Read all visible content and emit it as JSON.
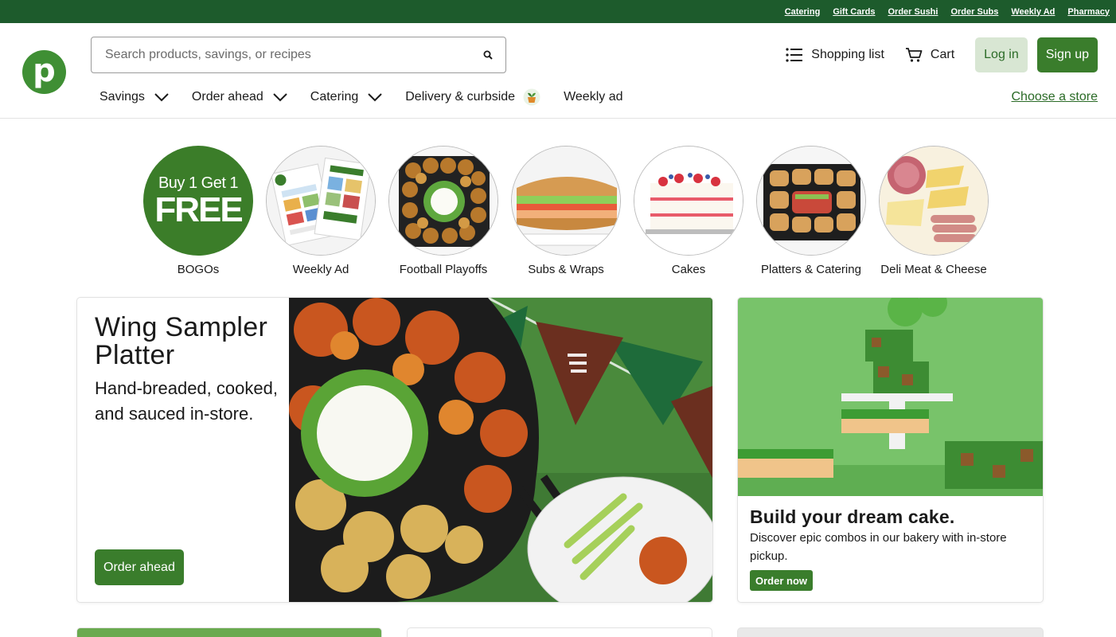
{
  "utility_links": [
    "Catering",
    "Gift Cards",
    "Order Sushi",
    "Order Subs",
    "Weekly Ad",
    "Pharmacy"
  ],
  "logo": {
    "letter": "p"
  },
  "search": {
    "placeholder": "Search products, savings, or recipes",
    "value": ""
  },
  "header": {
    "shopping_list": "Shopping list",
    "cart": "Cart",
    "login": "Log in",
    "signup": "Sign up"
  },
  "nav": {
    "items": [
      {
        "label": "Savings",
        "has_dropdown": true
      },
      {
        "label": "Order ahead",
        "has_dropdown": true
      },
      {
        "label": "Catering",
        "has_dropdown": true
      },
      {
        "label": "Delivery & curbside",
        "has_dropdown": false
      },
      {
        "label": "Weekly ad",
        "has_dropdown": false
      }
    ],
    "choose_store": "Choose a store"
  },
  "bogo_badge": {
    "line1": "Buy 1 Get 1",
    "line2": "FREE"
  },
  "categories": [
    {
      "label": "BOGOs",
      "icon": "bogo-badge"
    },
    {
      "label": "Weekly Ad",
      "icon": "weekly-ad-flyer"
    },
    {
      "label": "Football Playoffs",
      "icon": "wing-platter"
    },
    {
      "label": "Subs & Wraps",
      "icon": "sub-sandwich"
    },
    {
      "label": "Cakes",
      "icon": "cake-slice"
    },
    {
      "label": "Platters & Catering",
      "icon": "sandwich-platter"
    },
    {
      "label": "Deli Meat & Cheese",
      "icon": "deli-board"
    }
  ],
  "promo_wing": {
    "title": "Wing Sampler Platter",
    "subtitle": "Hand-breaded, cooked, and sauced in-store.",
    "button": "Order ahead"
  },
  "promo_cake": {
    "title": "Build your dream cake.",
    "description": "Discover epic combos in our bakery with in-store pickup.",
    "button": "Order now"
  },
  "colors": {
    "brand_green": "#3a7d2c",
    "utility_bar": "#1d5b2c",
    "login_bg": "#d8e6d3",
    "link_green": "#2b6b27"
  }
}
